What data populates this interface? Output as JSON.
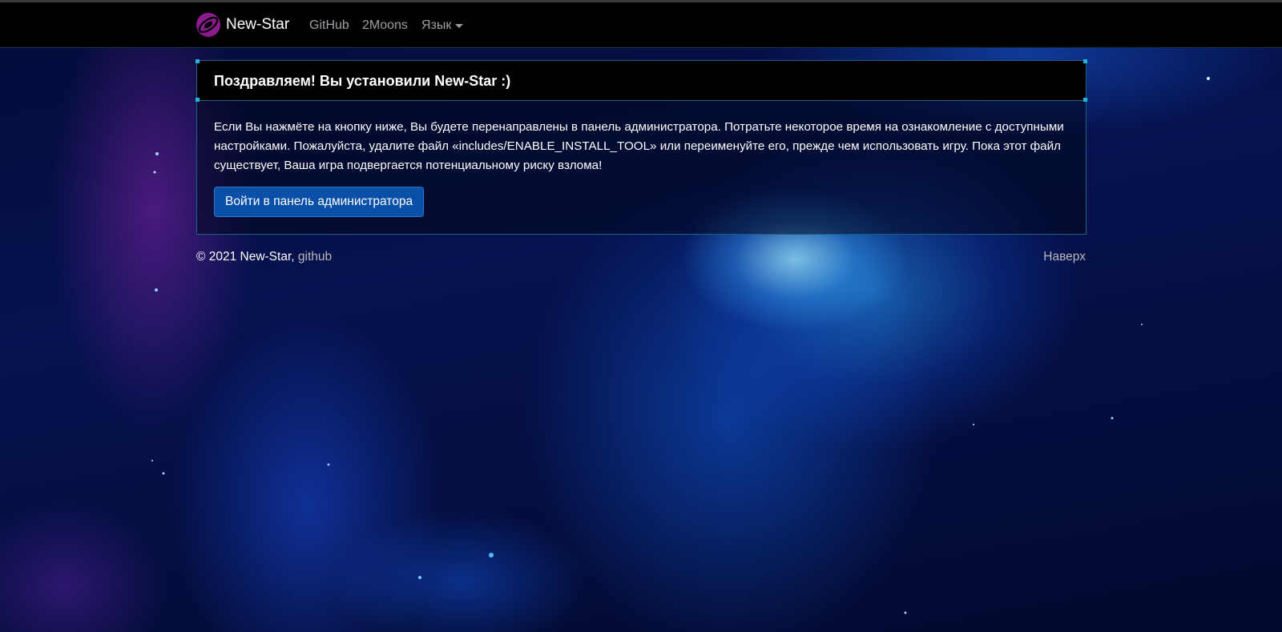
{
  "navbar": {
    "brand": "New-Star",
    "links": {
      "github": "GitHub",
      "moons": "2Moons",
      "language": "Язык"
    }
  },
  "card": {
    "title": "Поздравляем! Вы установили New-Star :)",
    "text": "Если Вы нажмёте на кнопку ниже, Вы будете перенаправлены в панель администратора. Потратьте некоторое время на ознакомление с доступными настройками. Пожалуйста, удалите файл «includes/ENABLE_INSTALL_TOOL» или переименуйте его, прежде чем использовать игру. Пока этот файл существует, Ваша игра подвергается потенциальному риску взлома!",
    "button": "Войти в панель администратора"
  },
  "footer": {
    "copyright": "© 2021 New-Star,",
    "github_link": "github",
    "to_top": "Наверх"
  },
  "colors": {
    "navbar_bg": "#000000",
    "card_border": "#1b5f85",
    "button_bg": "#0a4fa8",
    "logo": "#8b1a8f"
  }
}
